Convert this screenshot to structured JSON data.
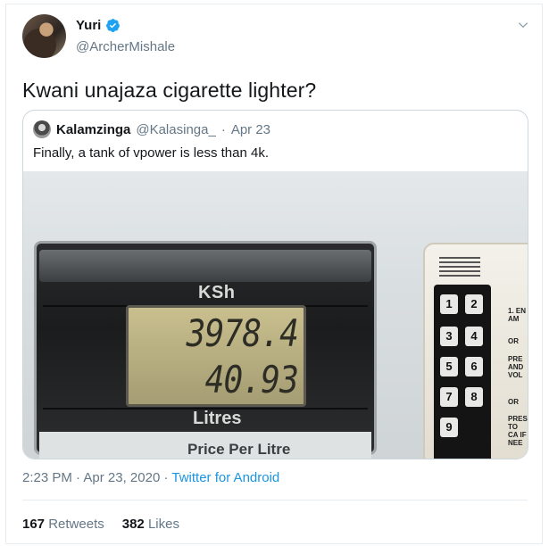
{
  "author": {
    "display_name": "Yuri",
    "handle": "@ArcherMishale",
    "verified": true
  },
  "tweet": {
    "text": "Kwani unajaza cigarette lighter?"
  },
  "quoted_tweet": {
    "display_name": "Kalamzinga",
    "handle": "@Kalasinga_",
    "separator": "·",
    "date": "Apr 23",
    "text": "Finally, a tank of vpower is less than 4k.",
    "photo": {
      "currency_label": "KSh",
      "amount_display": "3978.4",
      "litres_display": "40.93",
      "litres_label": "Litres",
      "price_per_litre_label": "Price Per Litre",
      "keys": [
        "1",
        "2",
        "3",
        "4",
        "5",
        "6",
        "7",
        "8",
        "9"
      ],
      "instructions": [
        "1. EN AM",
        "OR",
        "PRE AND VOL",
        "OR",
        "PRES TO CA IF NEE"
      ]
    }
  },
  "meta": {
    "time": "2:23 PM",
    "separator": "·",
    "date": "Apr 23, 2020",
    "source": "Twitter for Android"
  },
  "stats": {
    "retweets_count": "167",
    "retweets_label": "Retweets",
    "likes_count": "382",
    "likes_label": "Likes"
  },
  "icons": {
    "verified": "verified-badge-icon",
    "menu": "chevron-down-icon"
  },
  "colors": {
    "accent": "#1b95e0",
    "secondary_text": "#657786",
    "border": "#e6ecf0"
  }
}
